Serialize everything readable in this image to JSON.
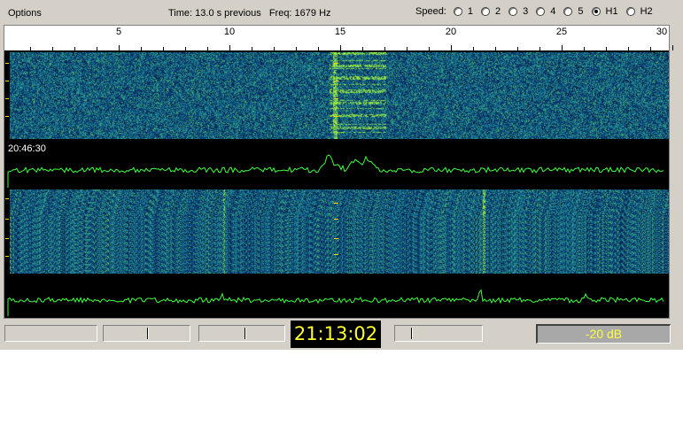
{
  "menu": {
    "options_label": "Options"
  },
  "status": {
    "time_text": "Time: 13.0 s previous",
    "freq_text": "Freq: 1679 Hz"
  },
  "speed": {
    "label": "Speed:",
    "options": [
      "1",
      "2",
      "3",
      "4",
      "5",
      "H1",
      "H2"
    ],
    "selected": "H1"
  },
  "ruler": {
    "labels": [
      "5",
      "10",
      "15",
      "20",
      "25",
      "30"
    ],
    "min": 0,
    "max": 30
  },
  "display": {
    "timestamp": "20:46:30"
  },
  "bottom": {
    "clock": "21:13:02",
    "level": "-20 dB"
  },
  "colors": {
    "trace": "#40ff40",
    "clock_text": "#ffff30",
    "marker": "#ffd400",
    "level_text": "#ffff40"
  }
}
